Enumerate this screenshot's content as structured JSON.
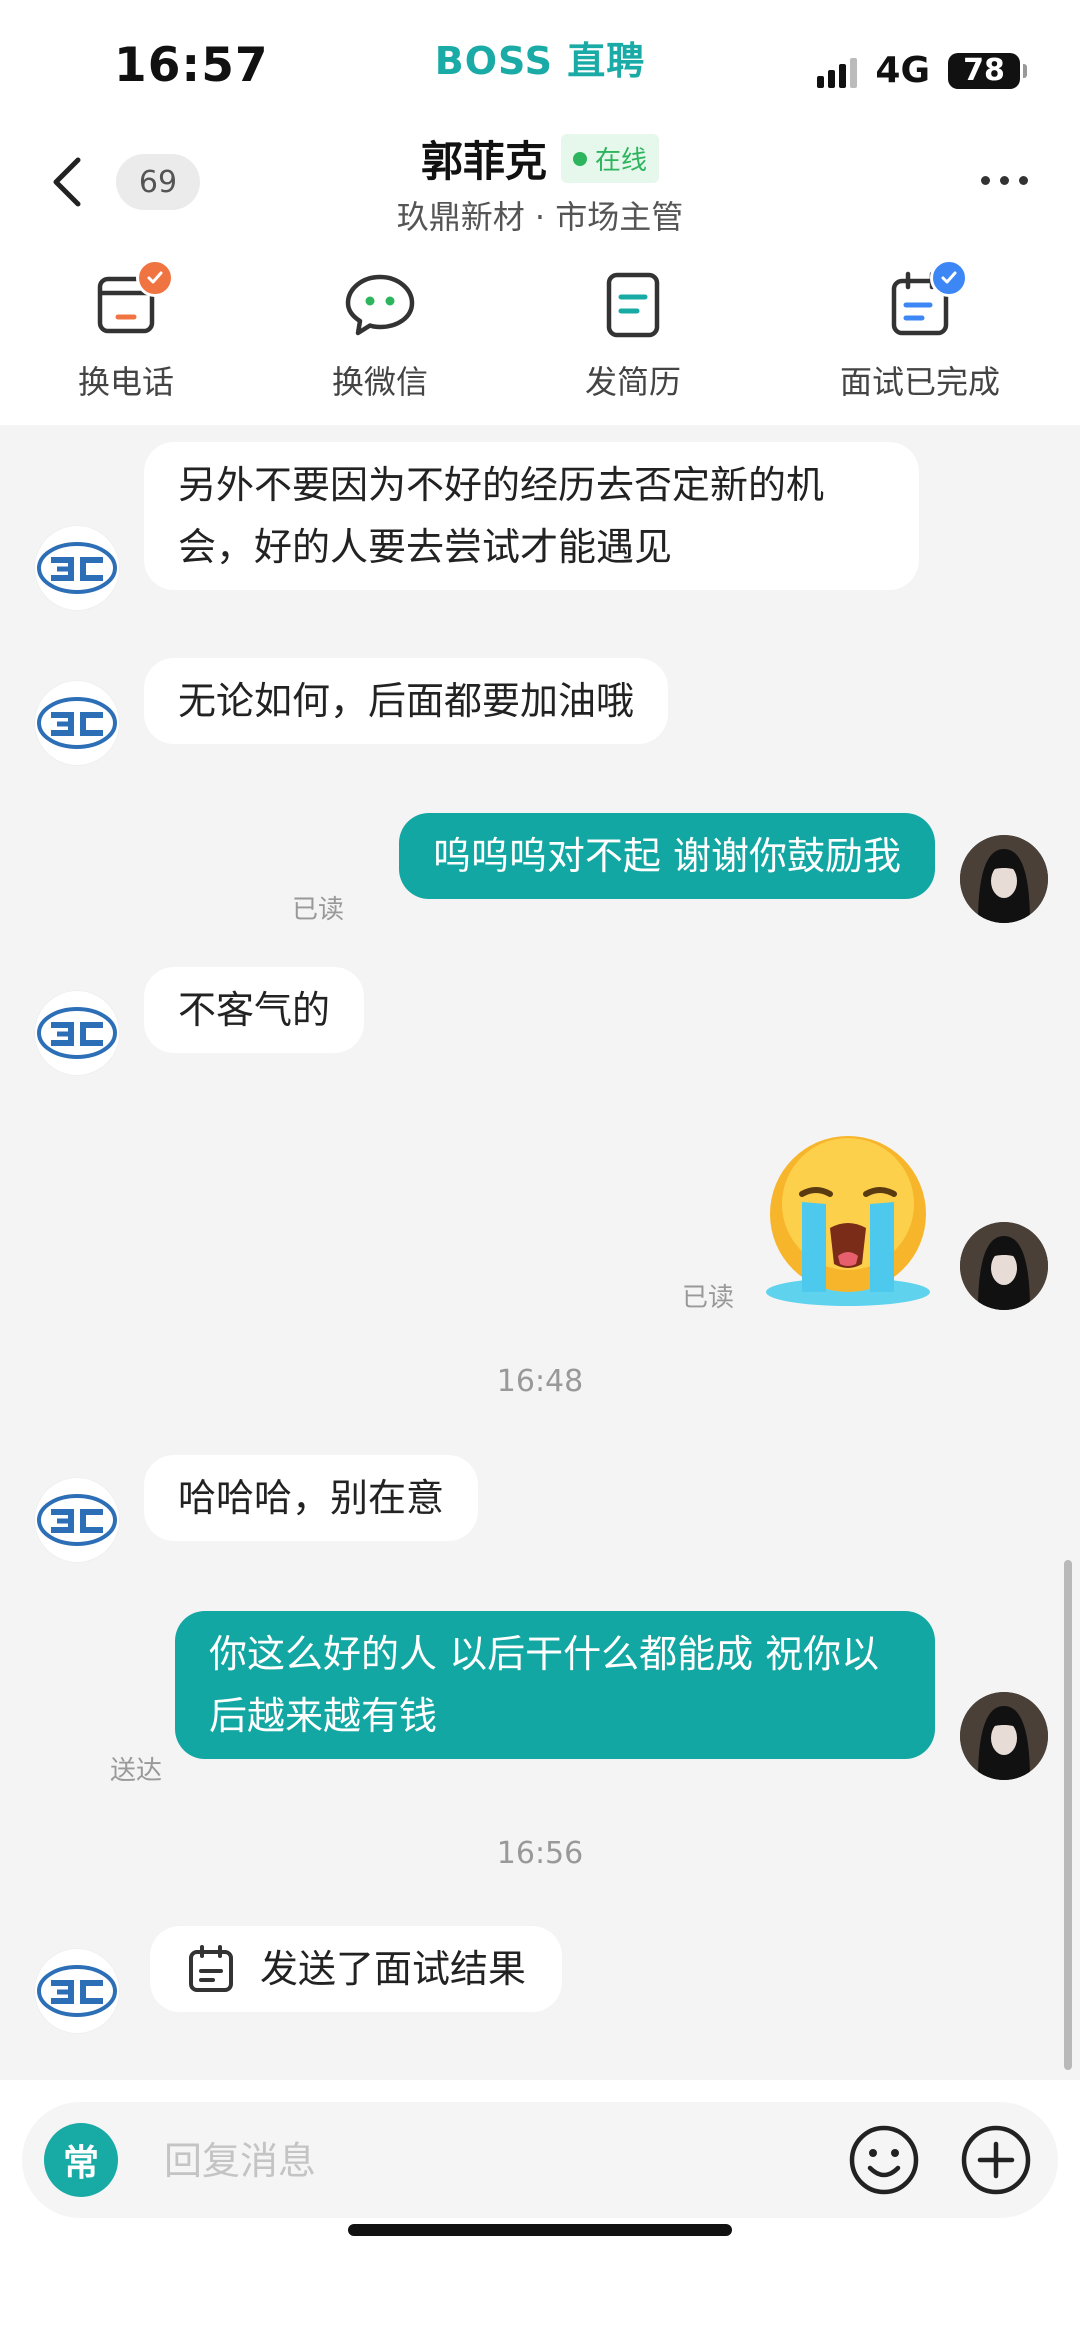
{
  "status_bar": {
    "time": "16:57",
    "brand": "BOSS 直聘",
    "network": "4G",
    "battery": "78"
  },
  "header": {
    "unread_count": "69",
    "contact_name": "郭菲克",
    "online_status": "在线",
    "subtitle": "玖鼎新材 · 市场主管"
  },
  "actions": [
    {
      "label": "换电话",
      "icon": "phone-icon"
    },
    {
      "label": "换微信",
      "icon": "wechat-icon"
    },
    {
      "label": "发简历",
      "icon": "resume-icon"
    },
    {
      "label": "面试已完成",
      "icon": "interview-done-icon"
    }
  ],
  "messages": {
    "m1": "另外不要因为不好的经历去否定新的机会，好的人要去尝试才能遇见",
    "m2": "无论如何，后面都要加油哦",
    "m3": "呜呜呜对不起 谢谢你鼓励我",
    "m3_status": "已读",
    "m4": "不客气的",
    "m5_status": "已读",
    "time1": "16:48",
    "m6": "哈哈哈，别在意",
    "m7": "你这么好的人 以后干什么都能成 祝你以后越来越有钱",
    "m7_status": "送达",
    "time2": "16:56",
    "m8": "发送了面试结果"
  },
  "input": {
    "common_label": "常",
    "placeholder": "回复消息"
  },
  "colors": {
    "brand": "#1aaba6",
    "outgoing_bubble": "#12a7a2",
    "online": "#2db55d",
    "badge_orange": "#f07442",
    "badge_blue": "#3d86f5"
  }
}
